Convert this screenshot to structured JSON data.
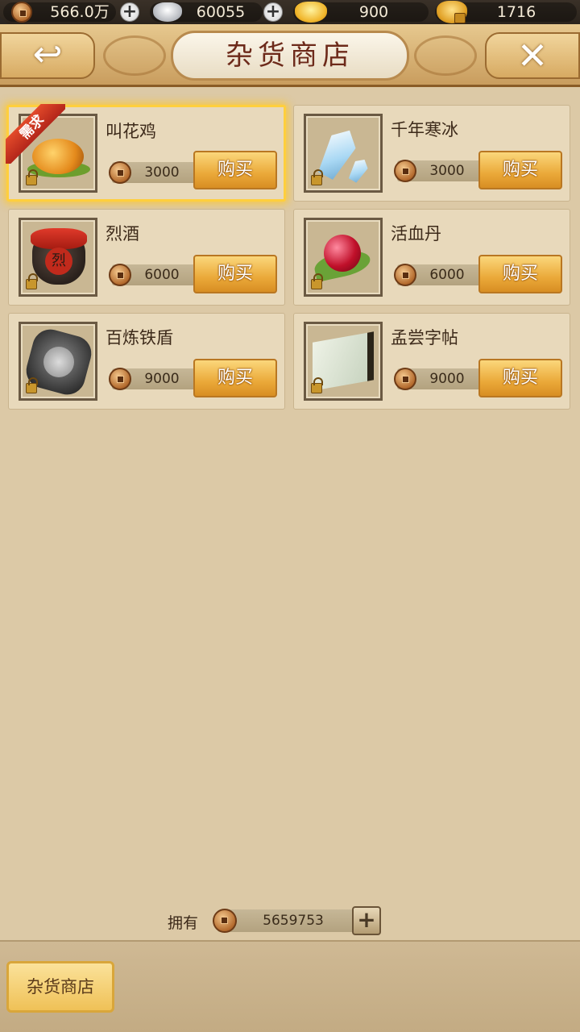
{
  "currency": {
    "copper": "566.0万",
    "silver": "60055",
    "gold": "900",
    "bound_gold": "1716"
  },
  "header": {
    "title": "杂货商店",
    "back_glyph": "↩",
    "close_glyph": "✕"
  },
  "items": [
    {
      "name": "叫花鸡",
      "price": "3000",
      "buy": "购买",
      "badge": "需求",
      "icon": "roast-chicken-icon"
    },
    {
      "name": "千年寒冰",
      "price": "3000",
      "buy": "购买",
      "icon": "ice-crystal-icon"
    },
    {
      "name": "烈酒",
      "price": "6000",
      "buy": "购买",
      "icon": "wine-jar-icon",
      "jar_char": "烈"
    },
    {
      "name": "活血丹",
      "price": "6000",
      "buy": "购买",
      "icon": "red-pill-icon"
    },
    {
      "name": "百炼铁盾",
      "price": "9000",
      "buy": "购买",
      "icon": "iron-shield-icon"
    },
    {
      "name": "孟尝字帖",
      "price": "9000",
      "buy": "购买",
      "icon": "calligraphy-book-icon"
    }
  ],
  "own": {
    "label": "拥有",
    "value": "5659753",
    "plus": "+"
  },
  "footer": {
    "tab": "杂货商店"
  },
  "colors": {
    "background": "#dcc9a6",
    "highlight": "#ffcf3d",
    "button": "#eaa939",
    "title_text": "#6d2a1a"
  }
}
